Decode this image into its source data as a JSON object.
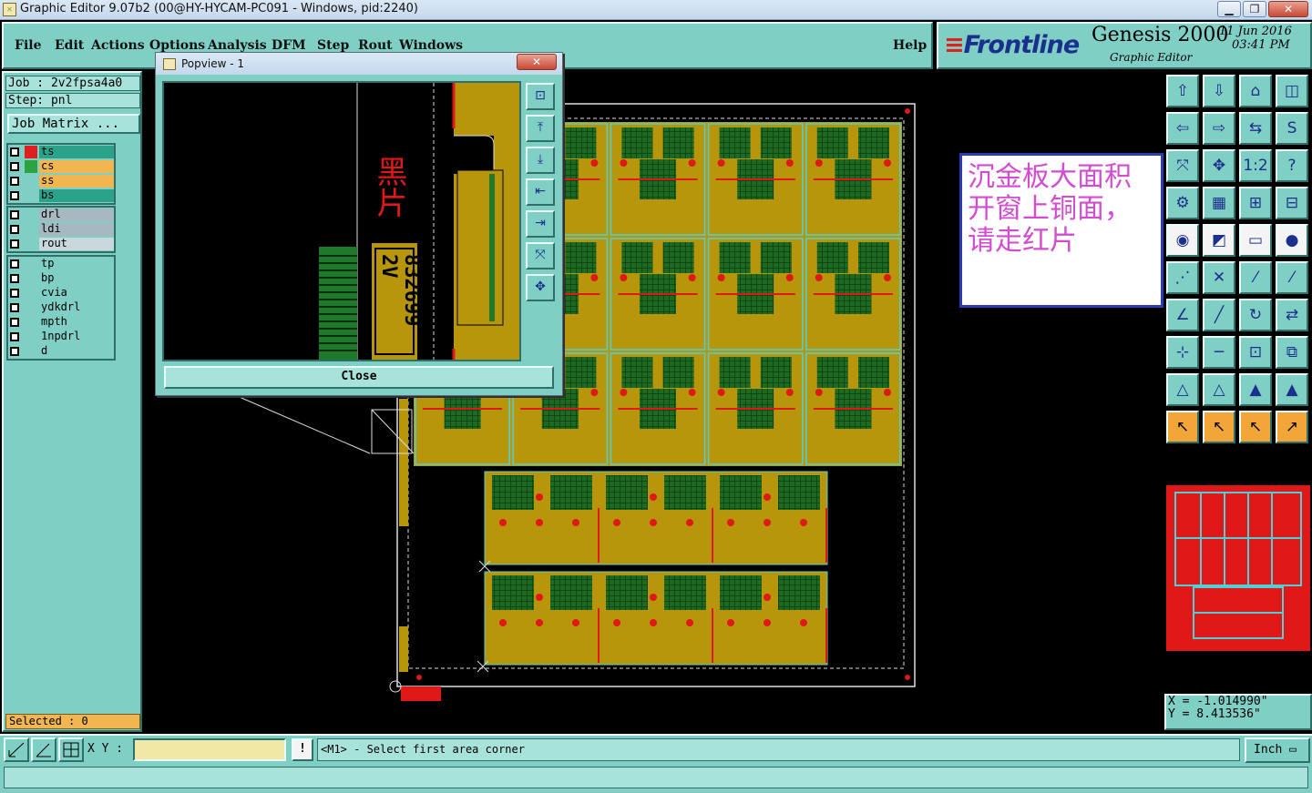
{
  "window": {
    "title": "Graphic Editor 9.07b2 (00@HY-HYCAM-PC091 - Windows, pid:2240)",
    "minimize_label": "▁",
    "restore_label": "❐",
    "close_label": "✕"
  },
  "menu": {
    "items": [
      "File",
      "Edit",
      "Actions",
      "Options",
      "Analysis",
      "DFM",
      "Step",
      "Rout",
      "Windows"
    ],
    "help": "Help"
  },
  "logo": {
    "brand": "Frontline",
    "product": "Genesis 2000",
    "subtitle": "Graphic Editor",
    "date": "11 Jun 2016",
    "time": "03:41 PM"
  },
  "job": {
    "job_label": "Job : 2v2fpsa4a0",
    "step_label": "Step: pnl",
    "matrix_button": "Job Matrix ..."
  },
  "layer_groups": [
    [
      {
        "name": "ts",
        "color": "#e02020",
        "bg": "#2aa38a"
      },
      {
        "name": "cs",
        "color": "#2aa340",
        "bg": "#f2b650"
      },
      {
        "name": "ss",
        "color": "",
        "bg": "#f2b650"
      },
      {
        "name": "bs",
        "color": "",
        "bg": "#2aa38a"
      }
    ],
    [
      {
        "name": "drl",
        "color": "",
        "bg": "#a8b8c0"
      },
      {
        "name": "ldi",
        "color": "",
        "bg": "#a8b8c0"
      },
      {
        "name": "rout",
        "color": "",
        "bg": "#c8d8dc"
      }
    ],
    [
      {
        "name": "tp",
        "color": "",
        "bg": "#7fcfc5"
      },
      {
        "name": "bp",
        "color": "",
        "bg": "#7fcfc5"
      },
      {
        "name": "cvia",
        "color": "",
        "bg": "#7fcfc5"
      },
      {
        "name": "ydkdrl",
        "color": "",
        "bg": "#7fcfc5"
      },
      {
        "name": "mpth",
        "color": "",
        "bg": "#7fcfc5"
      },
      {
        "name": "1npdrl",
        "color": "",
        "bg": "#7fcfc5"
      },
      {
        "name": "d",
        "color": "",
        "bg": "#7fcfc5"
      }
    ]
  ],
  "selected_label": "Selected : 0",
  "note": {
    "lines": [
      "沉金板大面积",
      "开窗上铜面，",
      "请走红片"
    ]
  },
  "popview": {
    "title": "Popview - 1",
    "close_label": "Close",
    "label_cn": "黑片",
    "label_code": "832699 2V",
    "tools": [
      "⊡",
      "⤒",
      "⤓",
      "⇤",
      "⇥",
      "⤧",
      "✥"
    ]
  },
  "coords": {
    "x": "X = -1.014990\"",
    "y": "Y = 8.413536\""
  },
  "status": {
    "xy_label": "X Y :",
    "xy_value": "",
    "warn": "!",
    "prompt": "<M1> - Select first area corner",
    "units": "Inch"
  },
  "colors": {
    "panel": "#7fcfc5",
    "copper": "#b8960c",
    "green": "#1e7a2a",
    "red": "#e01818",
    "cyan": "#4fd0d8"
  },
  "tool_icons": [
    [
      "home-up-icon",
      "home-down-icon",
      "house-icon",
      "window-icon"
    ],
    [
      "arrow-left-icon",
      "arrow-right-icon",
      "split-icon",
      "s-curve-icon"
    ],
    [
      "fit-icon",
      "pan-icon",
      "scale-1-2-icon",
      "question-icon"
    ],
    [
      "tool-icon",
      "grid-icon",
      "layers-icon",
      "layers-alt-icon"
    ],
    [
      "pad-icon",
      "measure-icon",
      "ruler-icon",
      "circle-icon"
    ],
    [
      "nodes-icon",
      "cross-icon",
      "line-icon",
      "snap-icon"
    ],
    [
      "angle-icon",
      "edit-line-icon",
      "rotate-icon",
      "flip-icon"
    ],
    [
      "move-icon",
      "minus-icon",
      "box-icon",
      "group-icon"
    ],
    [
      "triangle-icon",
      "triangle-up-icon",
      "arch-icon",
      "arch-line-icon"
    ],
    [
      "pointer-icon",
      "pointer-box-icon",
      "pointer-circle-icon",
      "pointer-path-icon"
    ]
  ]
}
